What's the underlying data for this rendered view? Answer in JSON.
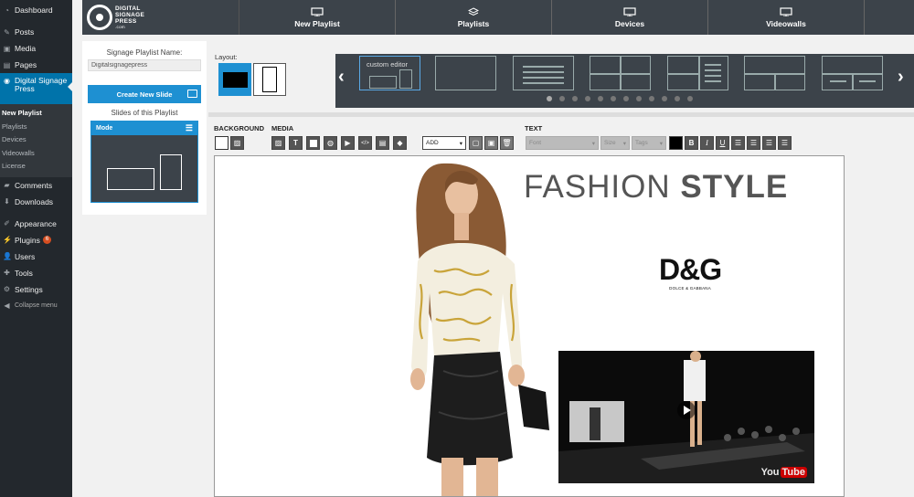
{
  "wp_menu": {
    "dashboard": "Dashboard",
    "posts": "Posts",
    "media": "Media",
    "pages": "Pages",
    "digital_signage": "Digital Signage Press",
    "submenu": [
      "New Playlist",
      "Playlists",
      "Devices",
      "Videowalls",
      "License"
    ],
    "comments": "Comments",
    "downloads": "Downloads",
    "appearance": "Appearance",
    "plugins": "Plugins",
    "plugins_badge": "6",
    "users": "Users",
    "tools": "Tools",
    "settings": "Settings",
    "collapse": "Collapse menu"
  },
  "topnav": {
    "logo_line1": "DIGITAL",
    "logo_line2": "SIGNAGE",
    "logo_line3": "PRESS",
    "logo_line4": ".com",
    "tabs": [
      {
        "label": "New Playlist",
        "icon": "new-playlist-icon"
      },
      {
        "label": "Playlists",
        "icon": "playlists-icon"
      },
      {
        "label": "Devices",
        "icon": "monitor-icon"
      },
      {
        "label": "Videowalls",
        "icon": "monitor-icon"
      }
    ]
  },
  "left_panel": {
    "playlist_name_label": "Signage Playlist Name:",
    "playlist_name_value": "Digitalsignagepress",
    "create_slide": "Create New Slide",
    "slides_label": "Slides of this Playlist",
    "slide_mode": "Mode"
  },
  "layout": {
    "label": "Layout:",
    "options": [
      "landscape",
      "portrait"
    ],
    "selected": "landscape"
  },
  "templates": {
    "first_label": "custom editor",
    "dot_count": 12,
    "active_dot": 0
  },
  "toolbar": {
    "background_label": "BACKGROUND",
    "media_label": "MEDIA",
    "text_label": "TEXT",
    "add_select": "ADD",
    "font_select": "Font",
    "size_select": "Size",
    "tags_select": "Tags",
    "bold": "B",
    "italic": "I",
    "underline": "U",
    "text_tool": "T"
  },
  "canvas": {
    "headline_light": "FASHION ",
    "headline_bold": "STYLE",
    "brand_logo": "D&G",
    "brand_sub": "DOLCE & GABBANA",
    "video_watermark_a": "You",
    "video_watermark_b": "Tube"
  },
  "colors": {
    "wp_sidebar": "#23282d",
    "wp_accent": "#0073aa",
    "nav_bg": "#3c434a",
    "button_blue": "#1e90d2",
    "plugin_badge": "#d54e21"
  }
}
